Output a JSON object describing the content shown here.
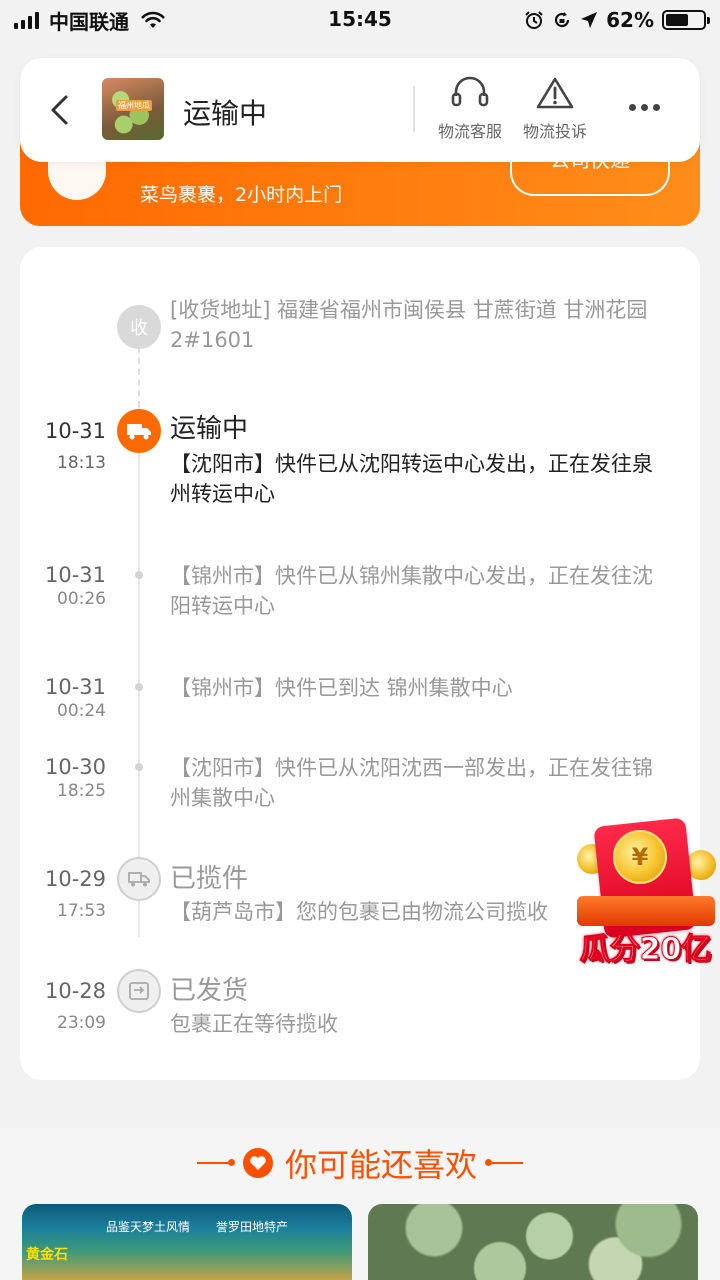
{
  "status_bar": {
    "carrier": "中国联通",
    "time": "15:45",
    "battery": "62%",
    "battery_level": 0.62
  },
  "banner": {
    "text": "菜鸟裹裹，2小时内上门",
    "button": "公司快递"
  },
  "header": {
    "title": "运输中",
    "thumb_tag": "福州地瓜",
    "actions": [
      {
        "label": "物流客服",
        "icon": "headset-icon"
      },
      {
        "label": "物流投诉",
        "icon": "warning-icon"
      }
    ]
  },
  "timeline": {
    "address": {
      "node_label": "收",
      "text": "[收货地址] 福建省福州市闽侯县  甘蔗街道   甘洲花园 2#1601"
    },
    "events": [
      {
        "date": "10-31",
        "time": "18:13",
        "status": "运输中",
        "desc": "【沈阳市】快件已从沈阳转运中心发出，正在发往泉州转运中心",
        "icon": "truck-icon",
        "active": true
      },
      {
        "date": "10-31",
        "time": "00:26",
        "status": "",
        "desc": "【锦州市】快件已从锦州集散中心发出，正在发往沈阳转运中心",
        "icon": "",
        "active": false
      },
      {
        "date": "10-31",
        "time": "00:24",
        "status": "",
        "desc": "【锦州市】快件已到达 锦州集散中心",
        "icon": "",
        "active": false
      },
      {
        "date": "10-30",
        "time": "18:25",
        "status": "",
        "desc": "【沈阳市】快件已从沈阳沈西一部发出，正在发往锦州集散中心",
        "icon": "",
        "active": false
      },
      {
        "date": "10-29",
        "time": "17:53",
        "status": "已揽件",
        "desc": "【葫芦岛市】您的包裹已由物流公司揽收",
        "icon": "pickup-truck-icon",
        "active": false
      },
      {
        "date": "10-28",
        "time": "23:09",
        "status": "已发货",
        "desc": "包裹正在等待揽收",
        "icon": "shipped-icon",
        "active": false
      }
    ]
  },
  "promo": {
    "coin_symbol": "¥",
    "text": "瓜分20亿"
  },
  "recommend": {
    "title": "你可能还喜欢",
    "item1_caption_a": "品鉴天梦土风情",
    "item1_caption_b": "誉罗田地特产",
    "item1_brand": "黄金石"
  },
  "colors": {
    "accent": "#ff6a00",
    "recommend": "#ff5000"
  }
}
